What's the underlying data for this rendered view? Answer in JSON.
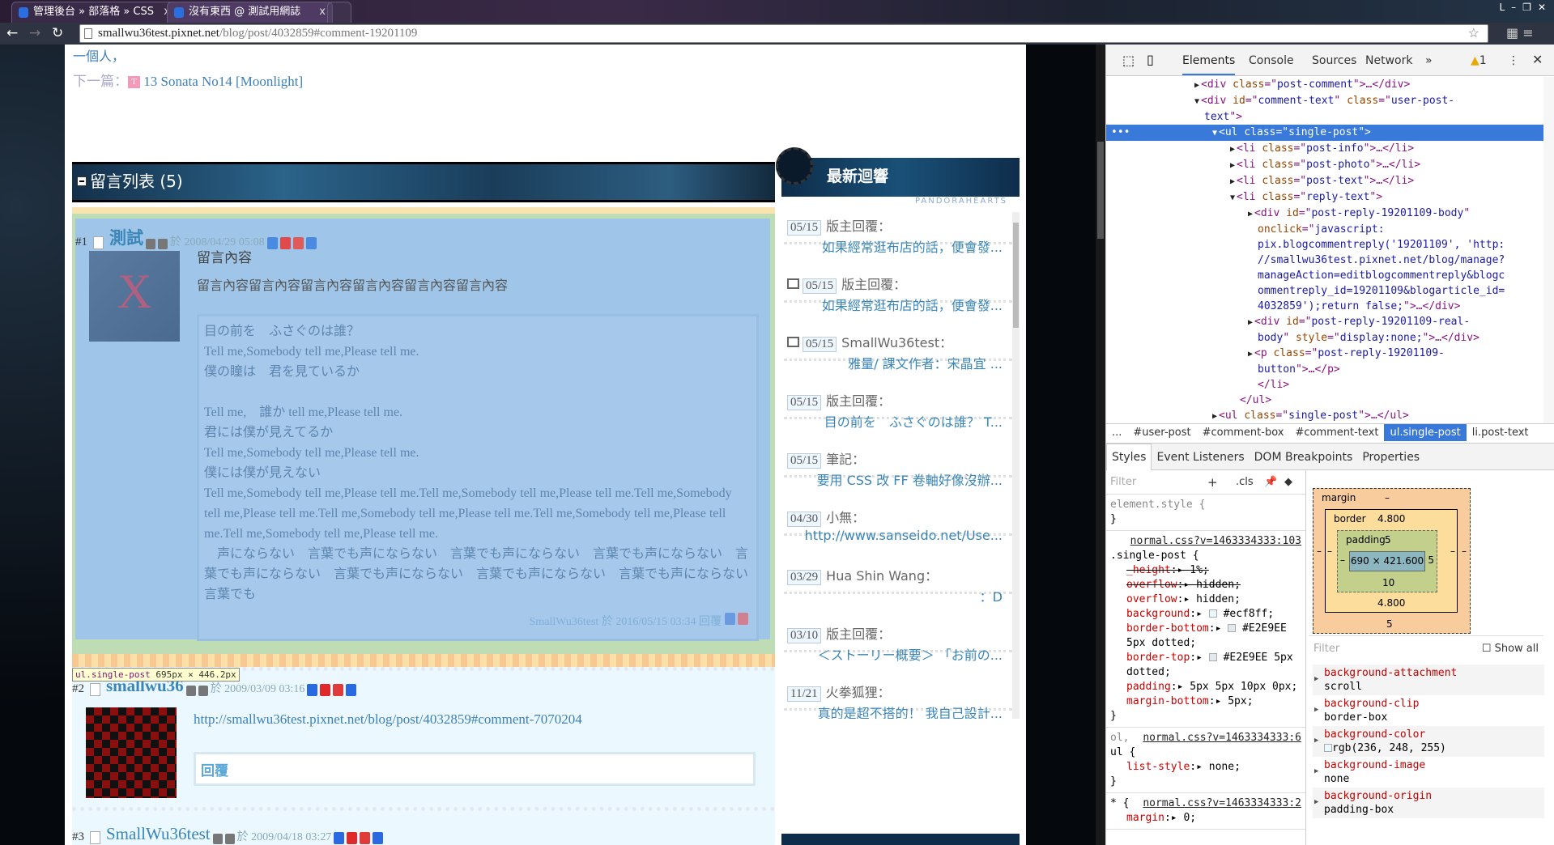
{
  "browser": {
    "tabs": [
      {
        "title": "管理後台 » 部落格 » CSS"
      },
      {
        "title": "沒有東西 @ 測試用網誌"
      }
    ],
    "tab_close": "x",
    "url_host": "smallwu36test.pixnet.net",
    "url_path": "/blog/post/4032859#comment-19201109",
    "window_controls": [
      "L",
      "–",
      "❐",
      "✕"
    ]
  },
  "page": {
    "prev_fragment": "一個人，",
    "next_label": "下一篇：",
    "next_icon": "T",
    "next_title": "13 Sonata No14 [Moonlight]",
    "comments_header": "留言列表 (5)",
    "comments": [
      {
        "num": "#1",
        "name": "測試",
        "date": "於 2008/04/29 05:08",
        "title": "留言內容",
        "body": "留言內容留言內容留言內容留言內容留言內容留言內容",
        "reply_lines": "目の前を　ふさぐのは誰？\nTell me,Somebody tell me,Please tell me.\n僕の瞳は　君を見ているか\n\nTell me,　誰か tell me,Please tell me.\n君には僕が見えてるか\nTell me,Somebody tell me,Please tell me.\n僕には僕が見えない\nTell me,Somebody tell me,Please tell me.Tell me,Somebody tell me,Please tell me.Tell me,Somebody tell me,Please tell me.Tell me,Somebody tell me,Please tell me.Tell me,Somebody tell me,Please tell me.Tell me,Somebody tell me,Please tell me.\n　声にならない　言葉でも声にならない　言葉でも声にならない　言葉でも声にならない　言葉でも声にならない　言葉でも声にならない　言葉でも声にならない　言葉でも声にならない　言葉でも",
        "reply_author": "SmallWu36test",
        "reply_date": "於 2016/05/15 03:34",
        "reply_label": "回覆"
      },
      {
        "num": "#2",
        "name": "smallwu36",
        "date": "於 2009/03/09 03:16",
        "body": "http://smallwu36test.pixnet.net/blog/post/4032859#comment-7070204",
        "reply_label": "回覆"
      },
      {
        "num": "#3",
        "name": "SmallWu36test",
        "date": "於 2009/04/18 03:27"
      }
    ],
    "inspect_tooltip": {
      "selector": "ul.single-post",
      "size": "695px × 446.2px"
    }
  },
  "sidebar": {
    "title": "最新迴響",
    "subtitle": "PANDORAHEARTS",
    "items": [
      {
        "date": "05/15",
        "who": "版主回覆：",
        "msg": "如果經常逛布店的話，便會發...",
        "trash": false
      },
      {
        "date": "05/15",
        "who": "版主回覆：",
        "msg": "如果經常逛布店的話，便會發...",
        "trash": true
      },
      {
        "date": "05/15",
        "who": "SmallWu36test：",
        "msg": "雅量/ 課文作者：宋晶宜 ...",
        "trash": true
      },
      {
        "date": "05/15",
        "who": "版主回覆：",
        "msg": "目の前を　ふさぐのは誰？ T...",
        "trash": false
      },
      {
        "date": "05/15",
        "who": "筆記：",
        "msg": "要用 CSS 改 FF 卷軸好像沒辦...",
        "trash": false
      },
      {
        "date": "04/30",
        "who": "小無：",
        "msg": "http://www.sanseido.net/Use...",
        "trash": false
      },
      {
        "date": "03/29",
        "who": "Hua Shin Wang：",
        "msg": "：D",
        "trash": false
      },
      {
        "date": "03/10",
        "who": "版主回覆：",
        "msg": "＜ストーリー概要＞ 「お前の...",
        "trash": false
      },
      {
        "date": "11/21",
        "who": "火拳狐狸：",
        "msg": "真的是超不搭的！ 我自己設計...",
        "trash": false
      }
    ]
  },
  "devtools": {
    "tabs": [
      "Elements",
      "Console",
      "Sources",
      "Network",
      "»"
    ],
    "warnings": "1",
    "dom_lines": [
      {
        "indent": 11,
        "arrow": "▶",
        "html": [
          [
            "tg",
            "<div "
          ],
          [
            "at",
            "class"
          ],
          [
            "tg",
            "=\""
          ],
          [
            "av",
            "post-comment"
          ],
          [
            "tg",
            "\">…</div>"
          ]
        ]
      },
      {
        "indent": 11,
        "arrow": "▼",
        "html": [
          [
            "tg",
            "<div "
          ],
          [
            "at",
            "id"
          ],
          [
            "tg",
            "=\""
          ],
          [
            "av",
            "comment-text"
          ],
          [
            "tg",
            "\" "
          ],
          [
            "at",
            "class"
          ],
          [
            "tg",
            "=\""
          ],
          [
            "av",
            "user-post-"
          ]
        ]
      },
      {
        "indent": 11,
        "arrow": "",
        "html": [
          [
            "av",
            "text"
          ],
          [
            "tg",
            "\">"
          ]
        ]
      },
      {
        "indent": 13,
        "arrow": "▼",
        "sel": true,
        "html": [
          [
            "tg",
            "<ul "
          ],
          [
            "at",
            "class"
          ],
          [
            "tg",
            "=\""
          ],
          [
            "av",
            "single-post"
          ],
          [
            "tg",
            "\">"
          ]
        ]
      },
      {
        "indent": 15,
        "arrow": "▶",
        "html": [
          [
            "tg",
            "<li "
          ],
          [
            "at",
            "class"
          ],
          [
            "tg",
            "=\""
          ],
          [
            "av",
            "post-info"
          ],
          [
            "tg",
            "\">…</li>"
          ]
        ]
      },
      {
        "indent": 15,
        "arrow": "▶",
        "html": [
          [
            "tg",
            "<li "
          ],
          [
            "at",
            "class"
          ],
          [
            "tg",
            "=\""
          ],
          [
            "av",
            "post-photo"
          ],
          [
            "tg",
            "\">…</li>"
          ]
        ]
      },
      {
        "indent": 15,
        "arrow": "▶",
        "html": [
          [
            "tg",
            "<li "
          ],
          [
            "at",
            "class"
          ],
          [
            "tg",
            "=\""
          ],
          [
            "av",
            "post-text"
          ],
          [
            "tg",
            "\">…</li>"
          ]
        ]
      },
      {
        "indent": 15,
        "arrow": "▼",
        "html": [
          [
            "tg",
            "<li "
          ],
          [
            "at",
            "class"
          ],
          [
            "tg",
            "=\""
          ],
          [
            "av",
            "reply-text"
          ],
          [
            "tg",
            "\">"
          ]
        ]
      },
      {
        "indent": 17,
        "arrow": "▶",
        "html": [
          [
            "tg",
            "<div "
          ],
          [
            "at",
            "id"
          ],
          [
            "tg",
            "=\""
          ],
          [
            "av",
            "post-reply-19201109-body"
          ],
          [
            "tg",
            "\""
          ]
        ]
      },
      {
        "indent": 17,
        "arrow": "",
        "html": [
          [
            "at",
            "onclick"
          ],
          [
            "tg",
            "=\""
          ],
          [
            "av",
            "javascript:"
          ]
        ]
      },
      {
        "indent": 17,
        "arrow": "",
        "html": [
          [
            "av",
            "pix.blogcommentreply('19201109', 'http:"
          ]
        ]
      },
      {
        "indent": 17,
        "arrow": "",
        "html": [
          [
            "av",
            "//smallwu36test.pixnet.net/blog/manage?"
          ]
        ]
      },
      {
        "indent": 17,
        "arrow": "",
        "html": [
          [
            "av",
            "manageAction=editblogcommentreply&blogc"
          ]
        ]
      },
      {
        "indent": 17,
        "arrow": "",
        "html": [
          [
            "av",
            "ommentreply_id=19201109&blogarticle_id="
          ]
        ]
      },
      {
        "indent": 17,
        "arrow": "",
        "html": [
          [
            "av",
            "4032859');return false;"
          ],
          [
            "tg",
            "\">…</div>"
          ]
        ]
      },
      {
        "indent": 17,
        "arrow": "▶",
        "html": [
          [
            "tg",
            "<div "
          ],
          [
            "at",
            "id"
          ],
          [
            "tg",
            "=\""
          ],
          [
            "av",
            "post-reply-19201109-real-"
          ]
        ]
      },
      {
        "indent": 17,
        "arrow": "",
        "html": [
          [
            "av",
            "body"
          ],
          [
            "tg",
            "\" "
          ],
          [
            "at",
            "style"
          ],
          [
            "tg",
            "=\""
          ],
          [
            "av",
            "display:none;"
          ],
          [
            "tg",
            "\">…</div>"
          ]
        ]
      },
      {
        "indent": 17,
        "arrow": "▶",
        "html": [
          [
            "tg",
            "<p "
          ],
          [
            "at",
            "class"
          ],
          [
            "tg",
            "=\""
          ],
          [
            "av",
            "post-reply-19201109-"
          ]
        ]
      },
      {
        "indent": 17,
        "arrow": "",
        "html": [
          [
            "av",
            "button"
          ],
          [
            "tg",
            "\">…</p>"
          ]
        ]
      },
      {
        "indent": 17,
        "arrow": "",
        "html": [
          [
            "tg",
            "</li>"
          ]
        ]
      },
      {
        "indent": 15,
        "arrow": "",
        "html": [
          [
            "tg",
            "</ul>"
          ]
        ]
      },
      {
        "indent": 13,
        "arrow": "▶",
        "html": [
          [
            "tg",
            "<ul "
          ],
          [
            "at",
            "class"
          ],
          [
            "tg",
            "=\""
          ],
          [
            "av",
            "single-post"
          ],
          [
            "tg",
            "\">…</ul>"
          ]
        ]
      },
      {
        "indent": 13,
        "arrow": "▶",
        "html": [
          [
            "tg",
            "<ul "
          ],
          [
            "at",
            "class"
          ],
          [
            "tg",
            "=\""
          ],
          [
            "av",
            "single-post"
          ],
          [
            "tg",
            "\">…</ul>"
          ]
        ]
      }
    ],
    "breadcrumbs": [
      "...",
      "#user-post",
      "#comment-box",
      "#comment-text",
      "ul.single-post",
      "li.post-text"
    ],
    "breadcrumb_active": 4,
    "side_tabs": [
      "Styles",
      "Event Listeners",
      "DOM Breakpoints",
      "Properties"
    ],
    "filter_placeholder": "Filter",
    "cls": ".cls",
    "plus": "+",
    "element_style": "element.style {",
    "close_brace": "}",
    "rule1_src": "normal.css?v=1463334333:103",
    "rule1_sel": ".single-post {",
    "rule1_props": [
      {
        "n": "_height",
        "v": " 1%;",
        "strike": true
      },
      {
        "n": "overflow",
        "v": "hidden;",
        "strike": true
      },
      {
        "n": "overflow",
        "v": "hidden;"
      },
      {
        "n": "background",
        "v": "#ecf8ff;",
        "sw": "#ecf8ff"
      },
      {
        "n": "border-bottom",
        "v": "#E2E9EE 5px dotted;",
        "sw": "#E2E9EE"
      },
      {
        "n": "border-top",
        "v": "#E2E9EE 5px dotted;",
        "sw": "#E2E9EE"
      },
      {
        "n": "padding",
        "v": "5px 5px 10px 0px;"
      },
      {
        "n": "margin-bottom",
        "v": " 5px;"
      }
    ],
    "rule2_pre": "ol,",
    "rule2_src": "normal.css?v=1463334333:6",
    "rule2_sel": "ul {",
    "rule2_prop": "list-style",
    "rule2_val": "none;",
    "rule3_sel": "* {",
    "rule3_src": "normal.css?v=1463334333:2",
    "rule3_prop": "margin",
    "rule3_val": "0;",
    "box": {
      "margin_label": "margin",
      "margin_top": "–",
      "margin_bottom": "5",
      "margin_left": "–",
      "margin_right": "–",
      "border_label": "border",
      "border_top": "4.800",
      "border_bottom": "4.800",
      "border_left": "–",
      "border_right": "–",
      "padding_label": "padding",
      "padding_top": "5",
      "padding_bottom": "10",
      "padding_left": "–",
      "padding_right": "5",
      "content": "690 × 421.600"
    },
    "show_all": "Show all",
    "computed": [
      {
        "n": "background-attachment",
        "v": "scroll"
      },
      {
        "n": "background-clip",
        "v": "border-box"
      },
      {
        "n": "background-color",
        "v": "rgb(236, 248, 255)",
        "sw": "#ecf8ff"
      },
      {
        "n": "background-image",
        "v": "none"
      },
      {
        "n": "background-origin",
        "v": "padding-box"
      }
    ]
  }
}
